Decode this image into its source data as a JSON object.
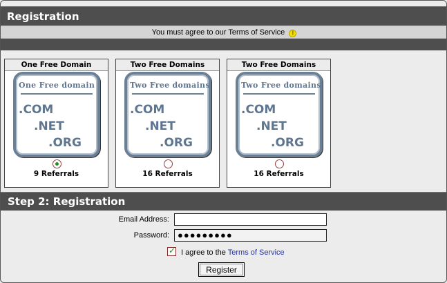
{
  "header": {
    "title": "Registration",
    "tos_notice": "You must agree to our Terms of Service",
    "notice_icon": "warning-icon"
  },
  "plans": [
    {
      "heading": "One Free Domain",
      "logo_title": "One Free domain",
      "tlds": [
        ".COM",
        ".NET",
        ".ORG"
      ],
      "referrals": "9 Referrals",
      "selected": true
    },
    {
      "heading": "Two Free Domains",
      "logo_title": "Two Free domains",
      "tlds": [
        ".COM",
        ".NET",
        ".ORG"
      ],
      "referrals": "16 Referrals",
      "selected": false
    },
    {
      "heading": "Two Free Domains",
      "logo_title": "Two Free domains",
      "tlds": [
        ".COM",
        ".NET",
        ".ORG"
      ],
      "referrals": "16 Referrals",
      "selected": false
    }
  ],
  "step2": {
    "title": "Step 2: Registration",
    "email_label": "Email Address:",
    "email_value": "",
    "password_label": "Password:",
    "password_value": "●●●●●●●●●",
    "agree_text": "I agree to the",
    "agree_link": "Terms of Service",
    "agree_checked": true,
    "register_label": "Register"
  },
  "colors": {
    "bar": "#4e4e4e",
    "logo_blue": "#5f7691",
    "link": "#2533a0",
    "check_green": "#1e8f1e"
  }
}
